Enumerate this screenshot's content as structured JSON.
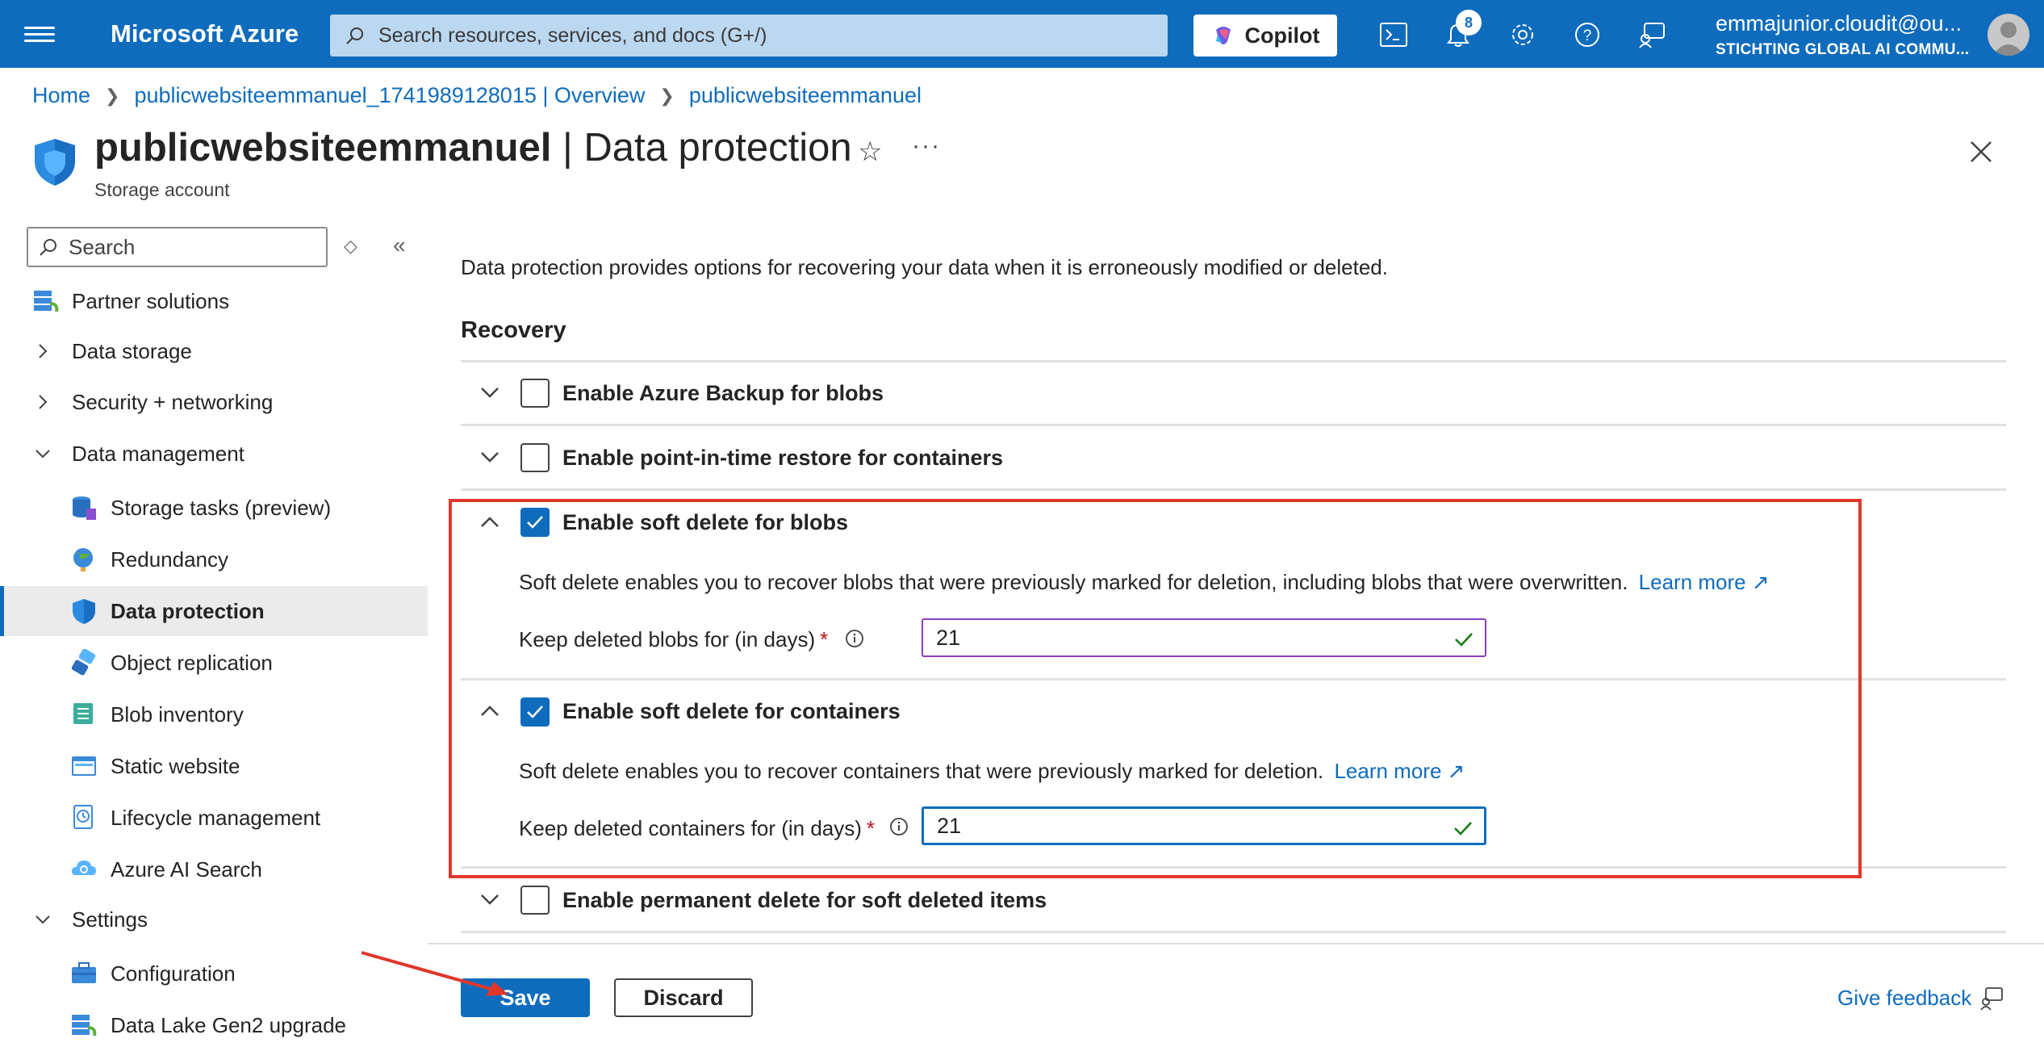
{
  "topbar": {
    "brand": "Microsoft Azure",
    "search_placeholder": "Search resources, services, and docs (G+/)",
    "copilot_label": "Copilot",
    "notification_count": "8",
    "user_email": "emmajunior.cloudit@ou...",
    "user_org": "STICHTING GLOBAL AI COMMU..."
  },
  "breadcrumb": {
    "items": [
      "Home",
      "publicwebsiteemmanuel_1741989128015 | Overview",
      "publicwebsiteemmanuel"
    ]
  },
  "header": {
    "resource_name": "publicwebsiteemmanuel",
    "page_name": " | Data protection",
    "subtitle": "Storage account"
  },
  "sidebar": {
    "search_placeholder": "Search",
    "items": [
      {
        "label": "Partner solutions",
        "icon": "partner-solutions-icon"
      },
      {
        "label": "Data storage",
        "icon": "chevron-right-icon"
      },
      {
        "label": "Security + networking",
        "icon": "chevron-right-icon"
      },
      {
        "label": "Data management",
        "icon": "chevron-down-icon"
      },
      {
        "label": "Storage tasks (preview)",
        "icon": "storage-tasks-icon"
      },
      {
        "label": "Redundancy",
        "icon": "redundancy-icon"
      },
      {
        "label": "Data protection",
        "icon": "shield-icon",
        "active": true
      },
      {
        "label": "Object replication",
        "icon": "object-replication-icon"
      },
      {
        "label": "Blob inventory",
        "icon": "blob-inventory-icon"
      },
      {
        "label": "Static website",
        "icon": "static-website-icon"
      },
      {
        "label": "Lifecycle management",
        "icon": "lifecycle-icon"
      },
      {
        "label": "Azure AI Search",
        "icon": "ai-search-icon"
      },
      {
        "label": "Settings",
        "icon": "chevron-down-icon"
      },
      {
        "label": "Configuration",
        "icon": "configuration-icon"
      },
      {
        "label": "Data Lake Gen2 upgrade",
        "icon": "data-lake-icon"
      }
    ]
  },
  "main": {
    "description": "Data protection provides options for recovering your data when it is erroneously modified or deleted.",
    "section_title": "Recovery",
    "rows": {
      "azure_backup": {
        "label": "Enable Azure Backup for blobs",
        "checked": false,
        "expanded": false
      },
      "point_in_time": {
        "label": "Enable point-in-time restore for containers",
        "checked": false,
        "expanded": false
      },
      "soft_delete_blobs": {
        "label": "Enable soft delete for blobs",
        "checked": true,
        "expanded": true,
        "help": "Soft delete enables you to recover blobs that were previously marked for deletion, including blobs that were overwritten.",
        "learn_more": "Learn more",
        "field_label": "Keep deleted blobs for (in days)",
        "required_mark": "*",
        "value": "21"
      },
      "soft_delete_containers": {
        "label": "Enable soft delete for containers",
        "checked": true,
        "expanded": true,
        "help": "Soft delete enables you to recover containers that were previously marked for deletion.",
        "learn_more": "Learn more",
        "field_label": "Keep deleted containers for (in days)",
        "required_mark": "*",
        "value": "21"
      },
      "permanent_delete": {
        "label": "Enable permanent delete for soft deleted items",
        "checked": false,
        "expanded": false
      }
    }
  },
  "footer": {
    "save_label": "Save",
    "discard_label": "Discard",
    "feedback_label": "Give feedback"
  },
  "colors": {
    "accent": "#0f6cbd",
    "highlight_box": "#e0372a",
    "required": "#c50f1f",
    "valid_check": "#107c10"
  }
}
